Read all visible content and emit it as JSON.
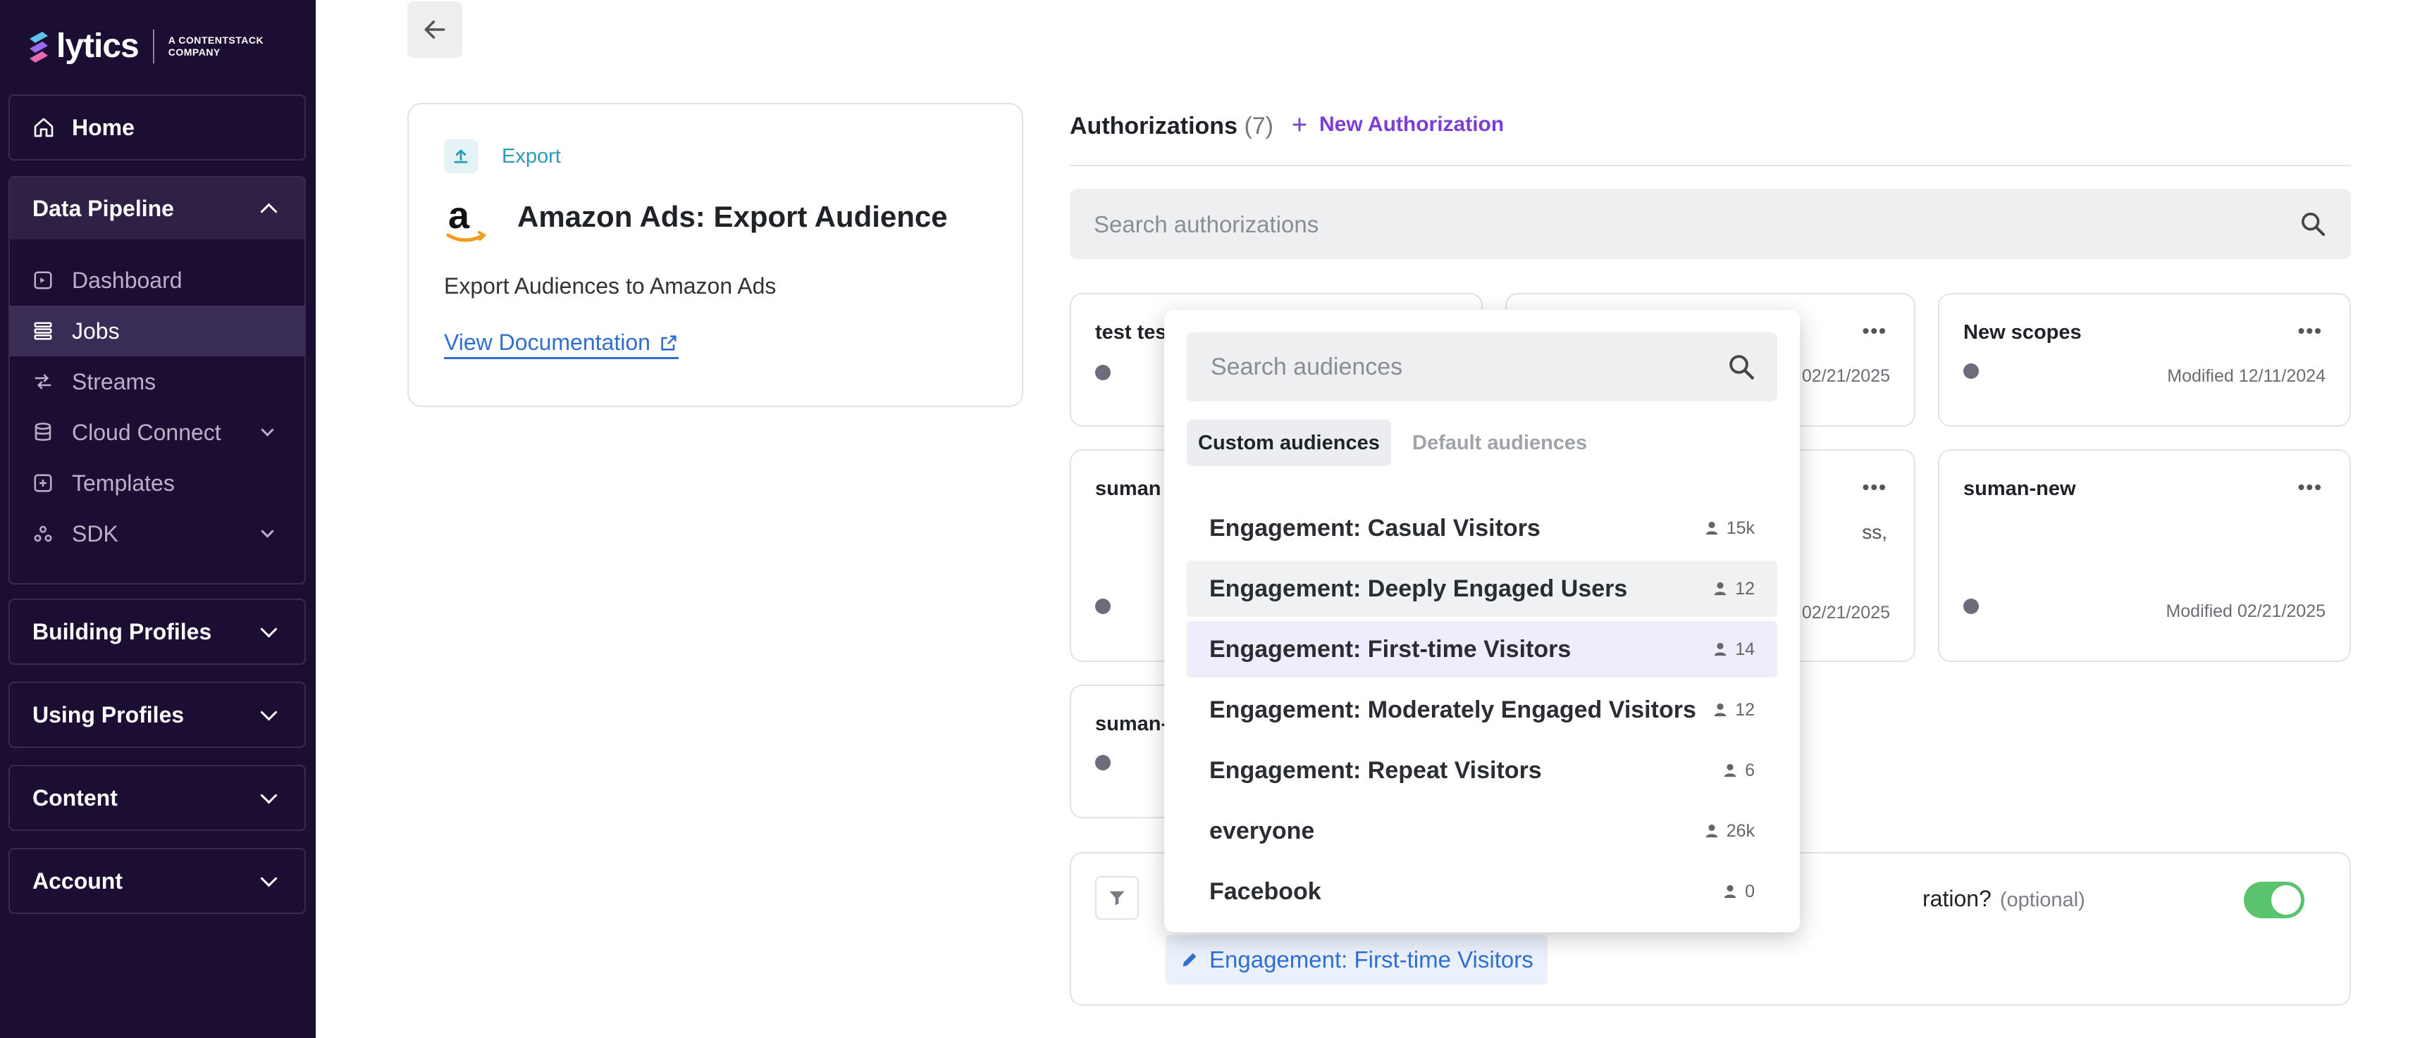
{
  "brand": {
    "logo_text": "lytics",
    "logo_sub_line1": "A CONTENTSTACK",
    "logo_sub_line2": "COMPANY"
  },
  "sidebar": {
    "home": "Home",
    "data_pipeline": {
      "label": "Data Pipeline",
      "items": [
        {
          "label": "Dashboard",
          "icon": "dashboard-icon"
        },
        {
          "label": "Jobs",
          "icon": "jobs-icon"
        },
        {
          "label": "Streams",
          "icon": "streams-icon"
        },
        {
          "label": "Cloud Connect",
          "icon": "database-icon"
        },
        {
          "label": "Templates",
          "icon": "templates-icon"
        },
        {
          "label": "SDK",
          "icon": "sdk-icon"
        }
      ]
    },
    "building_profiles": "Building Profiles",
    "using_profiles": "Using Profiles",
    "content": "Content",
    "account": "Account"
  },
  "job": {
    "type_label": "Export",
    "title": "Amazon Ads: Export Audience",
    "description": "Export Audiences to Amazon Ads",
    "docs_link": "View Documentation"
  },
  "authorizations": {
    "heading": "Authorizations",
    "count": "(7)",
    "new_label": "New Authorization",
    "search_placeholder": "Search authorizations",
    "cards": [
      {
        "name": "test tes",
        "modified": ""
      },
      {
        "name": "",
        "modified": "02/21/2025"
      },
      {
        "name": "New scopes",
        "modified": "Modified 12/11/2024"
      },
      {
        "name": "suman",
        "modified": ""
      },
      {
        "name": "",
        "modified": "02/21/2025",
        "fragment": "ss,"
      },
      {
        "name": "suman-new",
        "modified": "Modified 02/21/2025"
      },
      {
        "name": "suman-",
        "modified": ""
      }
    ]
  },
  "filter": {
    "question_fragment": "ration?",
    "optional": "(optional)",
    "selected_audience": "Engagement: First-time Visitors",
    "enabled": true
  },
  "audience_dropdown": {
    "search_placeholder": "Search audiences",
    "tabs": [
      "Custom audiences",
      "Default audiences"
    ],
    "active_tab": "Custom audiences",
    "items": [
      {
        "name": "Engagement: Casual Visitors",
        "count": "15k"
      },
      {
        "name": "Engagement: Deeply Engaged Users",
        "count": "12"
      },
      {
        "name": "Engagement: First-time Visitors",
        "count": "14"
      },
      {
        "name": "Engagement: Moderately Engaged Visitors",
        "count": "12"
      },
      {
        "name": "Engagement: Repeat Visitors",
        "count": "6"
      },
      {
        "name": "everyone",
        "count": "26k"
      },
      {
        "name": "Facebook",
        "count": "0"
      }
    ]
  },
  "colors": {
    "sidebar_bg": "#1c0d33",
    "accent_purple": "#7b3fd8",
    "link_blue": "#2f6fd0",
    "export_teal": "#2c9bb8",
    "toggle_green": "#5ac36d"
  }
}
